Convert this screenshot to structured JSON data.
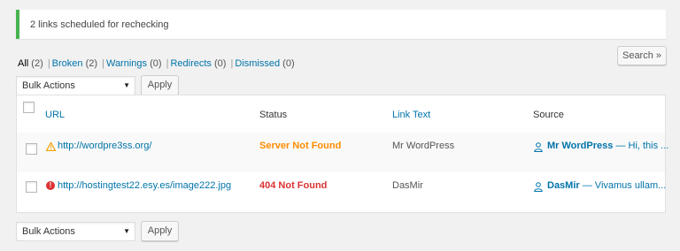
{
  "notice": {
    "message": "2 links scheduled for rechecking"
  },
  "search": {
    "button_label": "Search »"
  },
  "filters": [
    {
      "label": "All",
      "count": "(2)"
    },
    {
      "label": "Broken",
      "count": "(2)"
    },
    {
      "label": "Warnings",
      "count": "(0)"
    },
    {
      "label": "Redirects",
      "count": "(0)"
    },
    {
      "label": "Dismissed",
      "count": "(0)"
    }
  ],
  "bulk_top": {
    "select_value": "Bulk Actions",
    "apply_label": "Apply"
  },
  "bulk_bottom": {
    "select_value": "Bulk Actions",
    "apply_label": "Apply"
  },
  "table": {
    "headers": {
      "url": "URL",
      "status": "Status",
      "link_text": "Link Text",
      "source": "Source"
    },
    "rows": [
      {
        "url": "http://wordpre3ss.org/",
        "status": "Server Not Found",
        "status_color": "#ff8c00",
        "link_text": "Mr WordPress",
        "source_author": "Mr WordPress",
        "source_excerpt": "— Hi, this ...",
        "icon": "warning-icon"
      },
      {
        "url": "http://hostingtest22.esy.es/image222.jpg",
        "status": "404 Not Found",
        "status_color": "#dc3232",
        "link_text": "DasMir",
        "source_author": "DasMir",
        "source_excerpt": "— Vivamus ullam...",
        "icon": "error-icon"
      }
    ]
  },
  "colors": {
    "accent": "#0073aa",
    "notice_border": "#46b450"
  }
}
